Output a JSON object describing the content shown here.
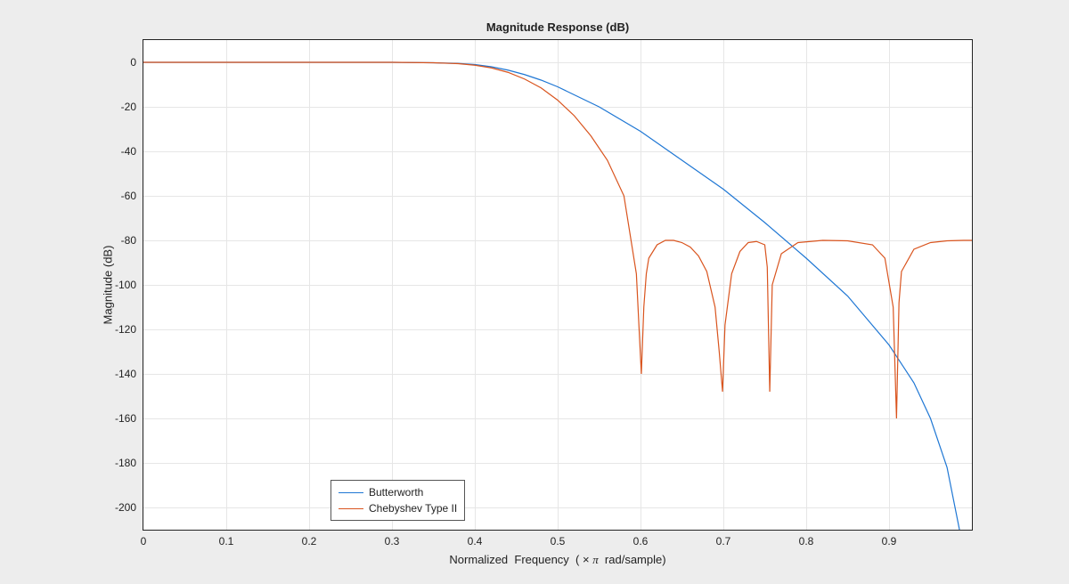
{
  "chart_data": {
    "type": "line",
    "title": "Magnitude Response (dB)",
    "xlabel": "Normalized  Frequency  ( × π  rad/sample)",
    "ylabel": "Magnitude (dB)",
    "xlim": [
      0,
      1
    ],
    "ylim": [
      -210,
      10
    ],
    "xticks": [
      0,
      0.1,
      0.2,
      0.3,
      0.4,
      0.5,
      0.6,
      0.7,
      0.8,
      0.9
    ],
    "yticks": [
      0,
      -20,
      -40,
      -60,
      -80,
      -100,
      -120,
      -140,
      -160,
      -180,
      -200
    ],
    "grid": true,
    "legend_position": "bottom-inside",
    "series": [
      {
        "name": "Butterworth",
        "color": "#1f77d4",
        "x": [
          0.0,
          0.05,
          0.1,
          0.15,
          0.2,
          0.25,
          0.3,
          0.35,
          0.38,
          0.4,
          0.42,
          0.44,
          0.46,
          0.48,
          0.5,
          0.55,
          0.6,
          0.65,
          0.7,
          0.75,
          0.8,
          0.85,
          0.9,
          0.93,
          0.95,
          0.97,
          0.985
        ],
        "y": [
          0,
          0,
          0,
          0,
          0,
          0,
          0,
          -0.2,
          -0.5,
          -1.0,
          -2.0,
          -3.5,
          -5.5,
          -8.0,
          -11.0,
          -20.0,
          -31.0,
          -44.0,
          -57.0,
          -72.0,
          -88.0,
          -105.0,
          -127.0,
          -144.0,
          -160.0,
          -182.0,
          -210.0
        ]
      },
      {
        "name": "Chebyshev Type II",
        "color": "#d9541e",
        "x": [
          0.0,
          0.05,
          0.1,
          0.15,
          0.2,
          0.25,
          0.3,
          0.35,
          0.38,
          0.4,
          0.42,
          0.44,
          0.46,
          0.48,
          0.5,
          0.52,
          0.54,
          0.56,
          0.58,
          0.595,
          0.601,
          0.604,
          0.607,
          0.61,
          0.62,
          0.63,
          0.64,
          0.65,
          0.66,
          0.67,
          0.68,
          0.69,
          0.695,
          0.699,
          0.702,
          0.71,
          0.72,
          0.73,
          0.74,
          0.75,
          0.753,
          0.756,
          0.759,
          0.77,
          0.79,
          0.82,
          0.85,
          0.88,
          0.895,
          0.905,
          0.909,
          0.912,
          0.915,
          0.93,
          0.95,
          0.97,
          0.99,
          1.0
        ],
        "y": [
          0,
          0,
          0,
          0,
          0,
          0,
          0,
          -0.2,
          -0.6,
          -1.3,
          -2.5,
          -4.5,
          -7.5,
          -11.5,
          -17.0,
          -24.0,
          -33.0,
          -44.0,
          -60.0,
          -95.0,
          -140.0,
          -110.0,
          -95.0,
          -88.0,
          -82.0,
          -80.0,
          -80.0,
          -81.0,
          -83.0,
          -87.0,
          -94.0,
          -110.0,
          -130.0,
          -148.0,
          -118.0,
          -95.0,
          -85.0,
          -81.0,
          -80.5,
          -82.0,
          -92.0,
          -148.0,
          -100.0,
          -86.0,
          -81.0,
          -80.0,
          -80.2,
          -82.0,
          -88.0,
          -110.0,
          -160.0,
          -108.0,
          -94.0,
          -84.0,
          -81.0,
          -80.2,
          -80.0,
          -80.0
        ]
      }
    ]
  },
  "legend": {
    "items": [
      {
        "label": "Butterworth",
        "color": "#1f77d4"
      },
      {
        "label": "Chebyshev Type II",
        "color": "#d9541e"
      }
    ]
  }
}
